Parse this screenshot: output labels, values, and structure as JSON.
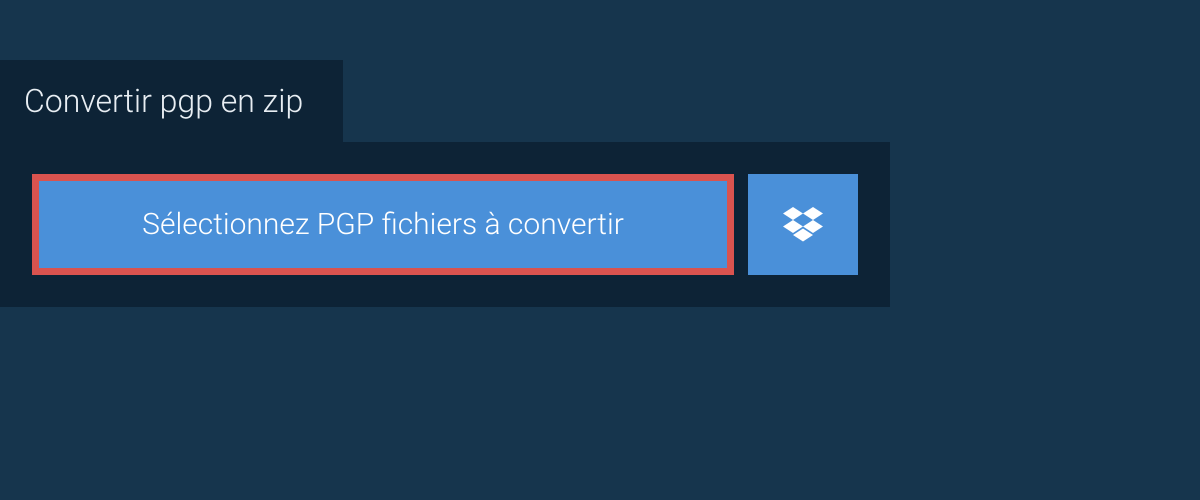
{
  "tab": {
    "label": "Convertir pgp en zip"
  },
  "buttons": {
    "select_files_label": "Sélectionnez PGP fichiers à convertir"
  },
  "colors": {
    "background": "#16354d",
    "panel": "#0d2336",
    "button": "#4a90d9",
    "highlight_border": "#d9534f"
  }
}
